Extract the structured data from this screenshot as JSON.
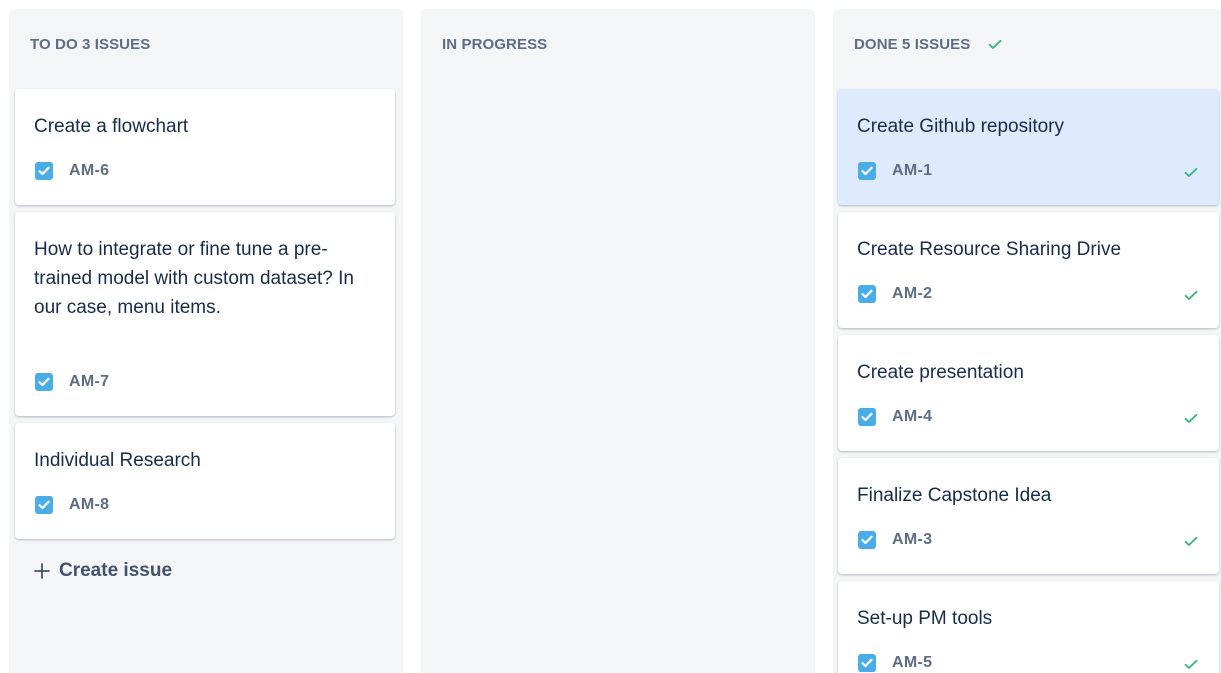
{
  "columns": {
    "todo": {
      "header": "TO DO 3 ISSUES",
      "create_issue_label": "Create issue",
      "cards": [
        {
          "title": "Create a flowchart",
          "key": "AM-6"
        },
        {
          "title": "How to integrate or fine tune a pre-trained model with custom dataset? In our case, menu items.",
          "key": "AM-7"
        },
        {
          "title": "Individual Research",
          "key": "AM-8"
        }
      ]
    },
    "in_progress": {
      "header": "IN PROGRESS",
      "cards": []
    },
    "done": {
      "header": "DONE 5 ISSUES",
      "cards": [
        {
          "title": "Create Github repository",
          "key": "AM-1",
          "selected": true
        },
        {
          "title": "Create Resource Sharing Drive",
          "key": "AM-2"
        },
        {
          "title": "Create presentation",
          "key": "AM-4"
        },
        {
          "title": "Finalize Capstone Idea",
          "key": "AM-3"
        },
        {
          "title": "Set-up PM tools",
          "key": "AM-5"
        }
      ]
    }
  },
  "icons": {
    "task": "checkbox-task-icon",
    "done": "checkmark-icon",
    "create": "plus-icon"
  },
  "colors": {
    "column_bg": "#f4f5f7",
    "card_bg": "#ffffff",
    "selected_card_bg": "#deebff",
    "task_icon": "#4bade8",
    "done_check": "#36b37e",
    "title_text": "#172b4d",
    "meta_text": "#5e6c84"
  }
}
